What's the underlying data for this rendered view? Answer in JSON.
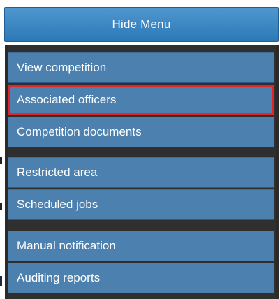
{
  "header": {
    "hide_menu_label": "Hide Menu"
  },
  "menu": {
    "groups": [
      {
        "items": [
          {
            "label": "View competition"
          },
          {
            "label": "Associated officers",
            "highlighted": true
          },
          {
            "label": "Competition documents"
          }
        ]
      },
      {
        "items": [
          {
            "label": "Restricted area"
          },
          {
            "label": "Scheduled jobs"
          }
        ]
      },
      {
        "items": [
          {
            "label": "Manual notification"
          },
          {
            "label": "Auditing reports"
          }
        ]
      }
    ]
  },
  "colors": {
    "header_button": "#3b86c4",
    "menu_item": "#4c80ae",
    "panel_bg": "#2f2f2f",
    "highlight_border": "#e0262a"
  }
}
